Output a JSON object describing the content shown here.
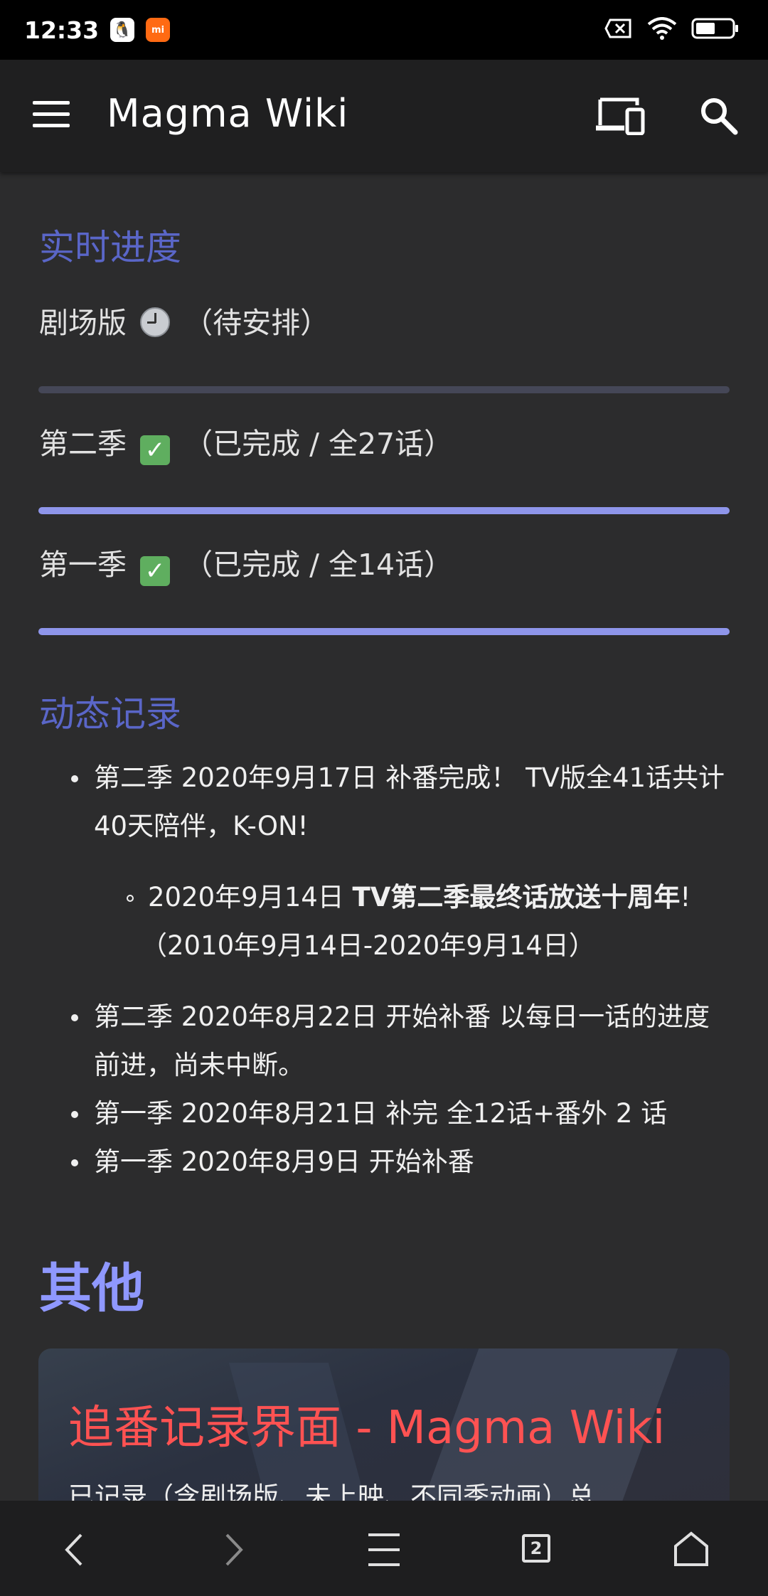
{
  "status_bar": {
    "time": "12:33",
    "apps": [
      "qq-icon",
      "mi-icon"
    ],
    "mi_label": "mi",
    "icons": [
      "no-sim-icon",
      "wifi-icon",
      "battery-icon"
    ]
  },
  "app_bar": {
    "title": "Magma Wiki",
    "icons": [
      "menu-icon",
      "devices-icon",
      "search-icon"
    ]
  },
  "progress": {
    "heading": "实时进度",
    "items": [
      {
        "label_a": "剧场版",
        "icon": "clock-icon",
        "label_b": "（待安排）",
        "progress": 0
      },
      {
        "label_a": "第二季",
        "icon": "check-mark-icon",
        "label_b": "（已完成 / 全27话）",
        "progress": 1
      },
      {
        "label_a": "第一季",
        "icon": "check-mark-icon",
        "label_b": "（已完成 / 全14话）",
        "progress": 1
      }
    ],
    "colors": {
      "track": "#454757",
      "fill": "#8e95ea",
      "heading": "#5a66c8"
    }
  },
  "log": {
    "heading": "动态记录",
    "items": [
      {
        "line1": "第二季 2020年9月17日 补番完成！ TV版全41话共计",
        "line2": "40天陪伴，K-ON!"
      },
      {
        "line1_a": "2020年9月14日 ",
        "line1_bold": "TV第二季最终话放送十周年",
        "line1_b": "!",
        "line2": "（2010年9月14日-2020年9月14日）"
      },
      {
        "line1": "第二季 2020年8月22日 开始补番 以每日一话的进度",
        "line2": "前进，尚未中断。"
      },
      {
        "line1": "第一季 2020年8月21日 补完 全12话+番外 2 话"
      },
      {
        "line1": "第一季 2020年8月9日 开始补番"
      }
    ]
  },
  "other": {
    "heading": "其他",
    "card": {
      "title": "追番记录界面 - Magma Wiki",
      "desc": "已记录（含剧场版、未上映、不同季动画）总"
    }
  },
  "nav_bar": {
    "tab_count": "2",
    "icons": [
      "back-icon",
      "forward-icon",
      "menu-lines-icon",
      "tabs-icon",
      "home-icon"
    ]
  }
}
